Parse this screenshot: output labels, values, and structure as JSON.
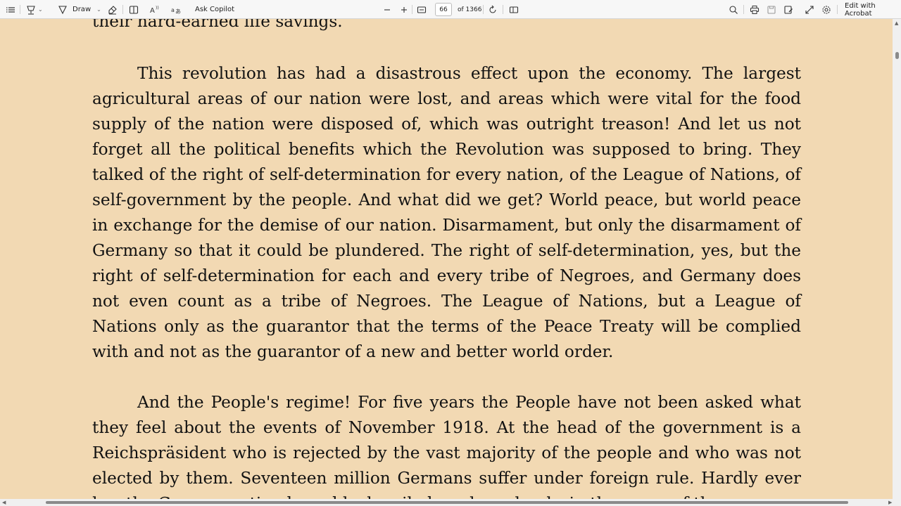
{
  "toolbar": {
    "draw_label": "Draw",
    "ask_copilot_label": "Ask Copilot",
    "page_number": "66",
    "page_total": "of 1366",
    "edit_acrobat_label": "Edit with Acrobat"
  },
  "document": {
    "cut_line": "their hard-earned life savings.",
    "paragraph_1": "This revolution has had a disastrous effect upon the economy. The largest agricultural areas of our nation were lost, and areas which were vital for the food supply of the nation were disposed of, which was outright treason! And let us not forget all the political benefits which the Revolution was supposed to bring. They talked of the right of self-determination for every nation, of the League of Nations, of self-government by the people. And what did we get? World peace, but world peace in exchange for the demise of our nation. Disarmament, but only the disarmament of Germany so that it could be plundered. The right of self-determination, yes, but the right of self-determination for each and every tribe of Negroes, and Germany does not even count as a tribe of Negroes. The League of Nations, but a League of Nations only as the guarantor that the terms of the Peace Treaty will be complied with and not as the guarantor of a new and better world order.",
    "paragraph_2": "And the People's regime! For five years the People have not been asked what they feel about the events of November 1918. At the head of the government is a Reichspräsident who is rejected by the vast majority of the people and who was not elected by them. Seventeen million Germans suffer under foreign rule. Hardly ever has the German nation been blackmailed so shamelessly, in the name of the"
  },
  "icons": [
    "contents-icon",
    "highlight-icon",
    "draw-icon",
    "erase-icon",
    "text-view-icon",
    "read-aloud-icon",
    "translate-icon",
    "zoom-out-icon",
    "zoom-in-icon",
    "fit-page-icon",
    "rotate-icon",
    "page-view-icon",
    "search-icon",
    "print-icon",
    "save-icon",
    "save-as-icon",
    "fullscreen-icon",
    "settings-icon"
  ],
  "colors": {
    "page_background": "#f2d9b3",
    "toolbar_background": "#f7f7f7"
  }
}
